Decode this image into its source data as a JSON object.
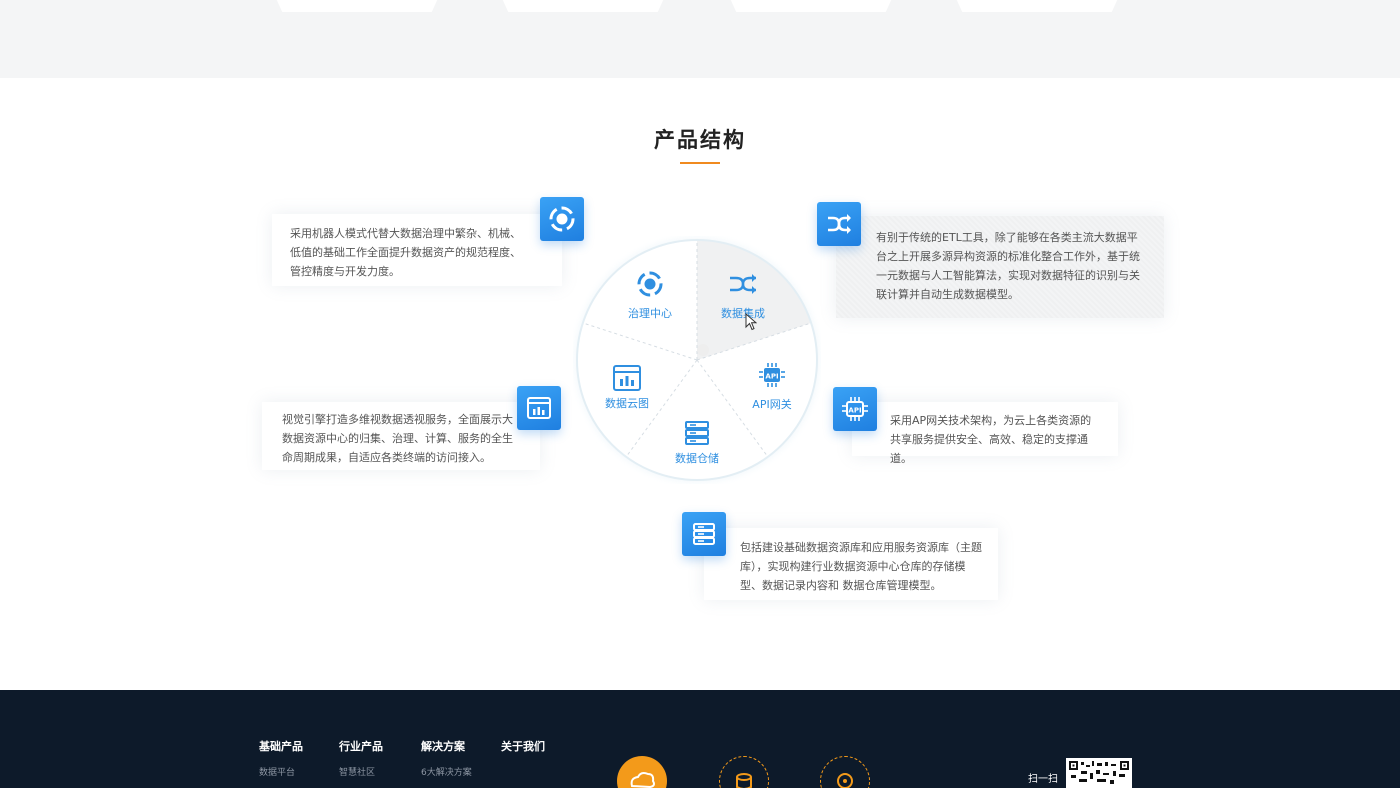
{
  "section": {
    "title": "产品结构"
  },
  "wheel": {
    "segments": [
      {
        "label": "治理中心",
        "icon": "governance-icon"
      },
      {
        "label": "数据集成",
        "icon": "integration-icon"
      },
      {
        "label": "API网关",
        "icon": "api-gateway-icon"
      },
      {
        "label": "数据仓储",
        "icon": "data-warehouse-icon"
      },
      {
        "label": "数据云图",
        "icon": "data-chart-icon"
      }
    ],
    "active": "数据集成"
  },
  "cards": {
    "governance": "采用机器人模式代替大数据治理中繁杂、机械、低值的基础工作全面提升数据资产的规范程度、管控精度与开发力度。",
    "integration": "有别于传统的ETL工具，除了能够在各类主流大数据平台之上开展多源异构资源的标准化整合工作外，基于统一元数据与人工智能算法，实现对数据特征的识别与关联计算并自动生成数据模型。",
    "chart": "视觉引擎打造多维视数据透视服务，全面展示大数据资源中心的归集、治理、计算、服务的全生命周期成果，自适应各类终端的访问接入。",
    "api": "采用AP网关技术架构，为云上各类资源的共享服务提供安全、高效、稳定的支撑通道。",
    "warehouse": "包括建设基础数据资源库和应用服务资源库（主题库），实现构建行业数据资源中心仓库的存储模型、数据记录内容和 数据仓库管理模型。"
  },
  "footer": {
    "columns": [
      {
        "heading": "基础产品",
        "link": "数据平台"
      },
      {
        "heading": "行业产品",
        "link": "智慧社区"
      },
      {
        "heading": "解决方案",
        "link": "6大解决方案"
      },
      {
        "heading": "关于我们",
        "link": ""
      }
    ],
    "scan_label": "扫一扫"
  },
  "colors": {
    "accent": "#f08a1f",
    "primary": "#2f8fe0",
    "footer_bg": "#0d1a2a"
  }
}
